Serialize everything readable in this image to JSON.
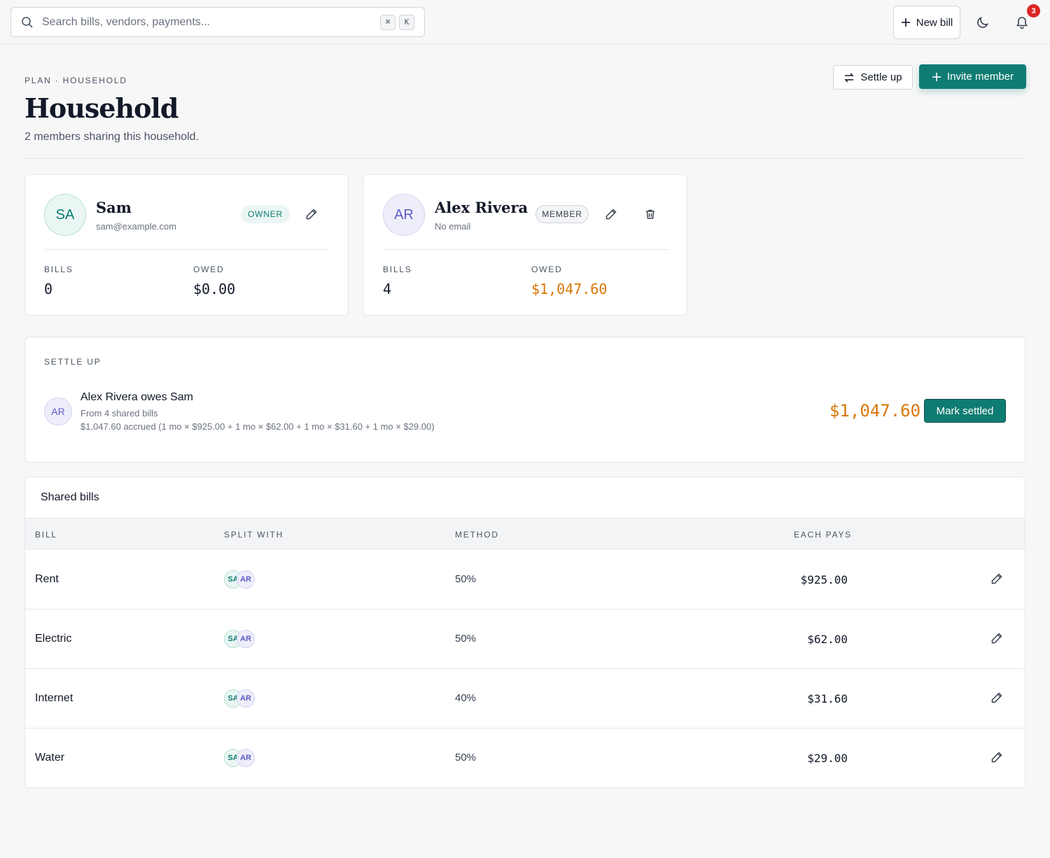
{
  "topbar": {
    "search_placeholder": "Search bills, vendors, payments...",
    "kbd": [
      "⌘",
      "K"
    ],
    "new_bill_label": "New bill",
    "notification_count": "3"
  },
  "header": {
    "eyebrow": "PLAN · HOUSEHOLD",
    "title": "Household",
    "subtitle": "2 members sharing this household.",
    "settle_up_label": "Settle up",
    "invite_label": "Invite member"
  },
  "members": [
    {
      "initials": "SA",
      "name": "Sam",
      "email": "sam@example.com",
      "role": "OWNER",
      "bills_label": "BILLS",
      "bills": "0",
      "owed_label": "OWED",
      "owed": "$0.00"
    },
    {
      "initials": "AR",
      "name": "Alex Rivera",
      "email": "No email",
      "role": "MEMBER",
      "bills_label": "BILLS",
      "bills": "4",
      "owed_label": "OWED",
      "owed": "$1,047.60"
    }
  ],
  "settle": {
    "label": "SETTLE UP",
    "initials": "AR",
    "title": "Alex Rivera owes Sam",
    "from": "From 4 shared bills",
    "breakdown": "$1,047.60 accrued (1 mo × $925.00 + 1 mo × $62.00 + 1 mo × $31.60 + 1 mo × $29.00)",
    "amount": "$1,047.60",
    "mark_settled_label": "Mark settled"
  },
  "bills_table": {
    "title": "Shared bills",
    "columns": [
      "BILL",
      "SPLIT WITH",
      "METHOD",
      "EACH PAYS"
    ],
    "rows": [
      {
        "bill": "Rent",
        "split": [
          "SA",
          "AR"
        ],
        "method": "50%",
        "each_pays": "$925.00"
      },
      {
        "bill": "Electric",
        "split": [
          "SA",
          "AR"
        ],
        "method": "50%",
        "each_pays": "$62.00"
      },
      {
        "bill": "Internet",
        "split": [
          "SA",
          "AR"
        ],
        "method": "40%",
        "each_pays": "$31.60"
      },
      {
        "bill": "Water",
        "split": [
          "SA",
          "AR"
        ],
        "method": "50%",
        "each_pays": "$29.00"
      }
    ]
  },
  "colors": {
    "accent": "#0f7c73",
    "owed": "#d97706",
    "badge": "#dc2626"
  },
  "icons": [
    "search-icon",
    "plus-icon",
    "moon-icon",
    "bell-icon",
    "swap-icon",
    "pencil-icon",
    "trash-icon"
  ]
}
